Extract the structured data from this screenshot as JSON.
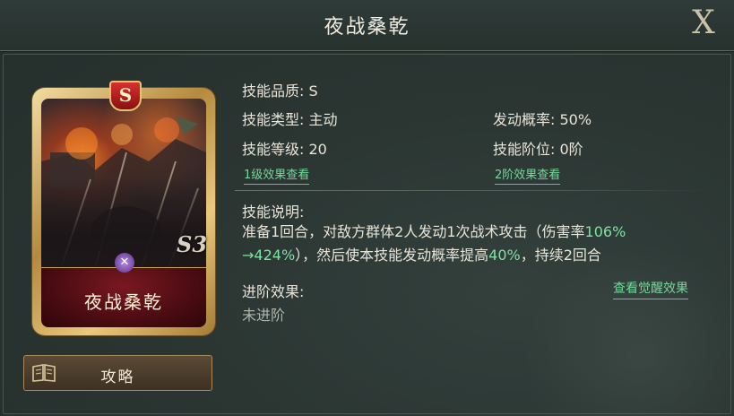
{
  "window": {
    "title": "夜战桑乾",
    "close_label": "X"
  },
  "card": {
    "name": "夜战桑乾",
    "grade_badge": "S",
    "level_mark": "S3",
    "type_icon": "crossed-swords-icon"
  },
  "guide_button": {
    "label": "攻略",
    "icon": "book-icon"
  },
  "skill": {
    "quality": "技能品质: S",
    "type": "技能类型: 主动",
    "trigger_rate": "发动概率: 50%",
    "level": "技能等级: 20",
    "tier": "技能阶位: 0阶",
    "link_level1": "1级效果查看",
    "link_tier2": "2阶效果查看",
    "description_label": "技能说明:",
    "description_part1": "准备1回合，对敌方群体2人发动1次战术攻击（伤害率",
    "description_hl1": "106%",
    "description_hl2": "→424%",
    "description_part2": "），然后使本技能发动概率提高",
    "description_hl3": "40%",
    "description_part3": "，持续2回合",
    "advance_label": "进阶效果:",
    "advance_value": "未进阶",
    "awaken_link": "查看觉醒效果"
  },
  "colors": {
    "accent_green": "#7ee3a2",
    "panel_bg": "#2b3633",
    "card_gold": "#d9b264",
    "card_red": "#6a1218"
  }
}
